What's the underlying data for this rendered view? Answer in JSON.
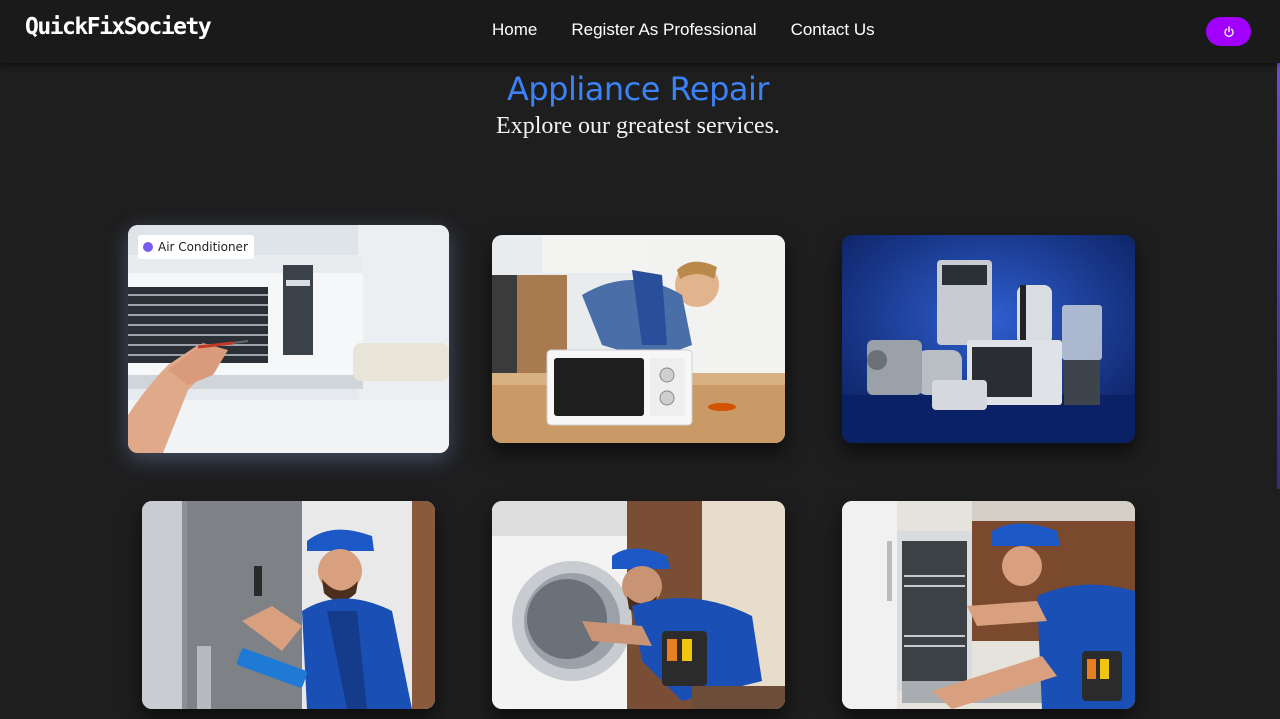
{
  "brand": "QuickFixSociety",
  "nav": [
    {
      "label": "Home"
    },
    {
      "label": "Register As Professional"
    },
    {
      "label": "Contact Us"
    }
  ],
  "hero": {
    "title": "Appliance Repair",
    "subtitle": "Explore our greatest services."
  },
  "services": [
    {
      "tag": "Air Conditioner",
      "image": "air-conditioner-repair"
    },
    {
      "image": "microwave-repair"
    },
    {
      "image": "kitchen-appliances"
    },
    {
      "image": "refrigerator-repair"
    },
    {
      "image": "washing-machine-repair"
    },
    {
      "image": "dishwasher-repair"
    }
  ],
  "colors": {
    "background": "#1e1e1f",
    "navbar": "#1a1a1a",
    "accent": "#3b82f6",
    "power_button": "#a100ff"
  },
  "icons": {
    "power": "power-icon",
    "tag_dot": "purple-dot-icon"
  }
}
